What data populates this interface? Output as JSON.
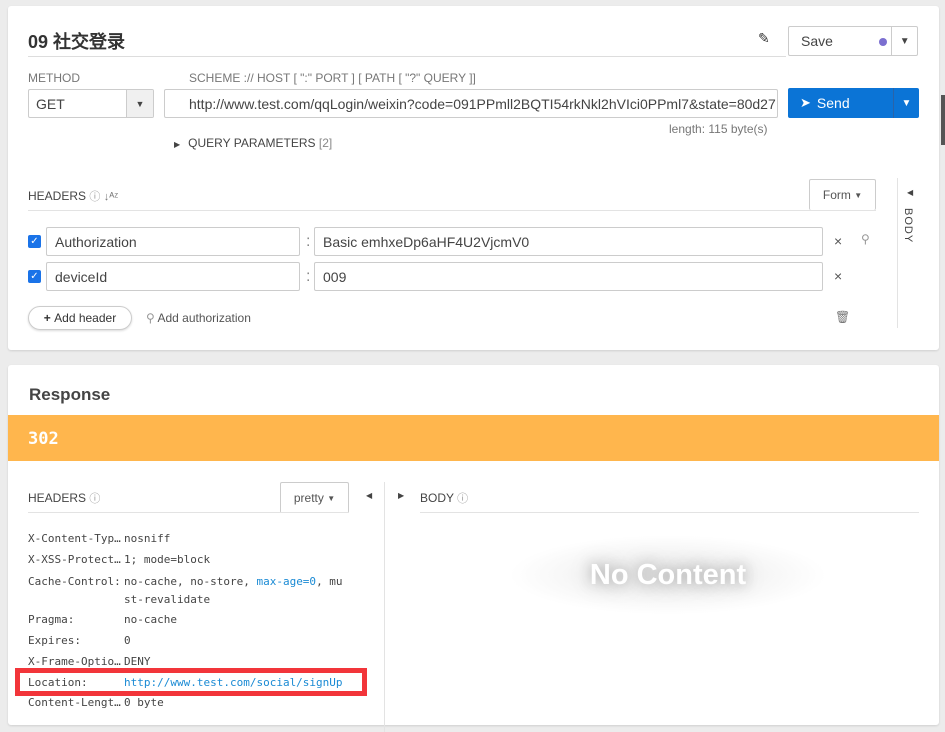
{
  "request": {
    "title": "09 社交登录",
    "save_label": "Save",
    "method_label": "METHOD",
    "method": "GET",
    "url_label": "SCHEME :// HOST [ \":\" PORT ] [ PATH [ \"?\" QUERY ]]",
    "url": "http://www.test.com/qqLogin/weixin?code=091PPmll2BQTI54rkNkl2hVIci0PPml7&state=80d27",
    "length": "length: 115 byte(s)",
    "send_label": "Send",
    "query_params_label": "QUERY PARAMETERS",
    "query_params_count": "[2]",
    "headers_label": "HEADERS",
    "form_label": "Form",
    "body_label": "BODY",
    "headers": [
      {
        "enabled": true,
        "key": "Authorization",
        "value": "Basic emhxeDp6aHF4U2VjcmV0"
      },
      {
        "enabled": true,
        "key": "deviceId",
        "value": "009"
      }
    ],
    "add_header_label": "Add header",
    "add_authorization_label": "Add authorization"
  },
  "response": {
    "title": "Response",
    "status": "302",
    "status_color": "#ffb64d",
    "headers_label": "HEADERS",
    "pretty_label": "pretty",
    "body_label": "BODY",
    "no_content": "No Content",
    "headers": [
      {
        "key": "X-Content-Typ…",
        "value": "nosniff"
      },
      {
        "key": "X-XSS-Protect…",
        "value": "1; mode=block"
      },
      {
        "key": "Cache-Control:",
        "value_pre": "no-cache, no-store, ",
        "value_link": "max-age=0",
        "value_post": ", mu",
        "value_line2": "st-revalidate"
      },
      {
        "key": "Pragma:",
        "value": "no-cache"
      },
      {
        "key": "Expires:",
        "value": "0"
      },
      {
        "key": "X-Frame-Optio…",
        "value": "DENY"
      },
      {
        "key": "Location:",
        "value": "http://www.test.com/social/signUp",
        "highlighted": true
      },
      {
        "key": "Content-Lengt…",
        "value": "0 byte"
      }
    ]
  }
}
